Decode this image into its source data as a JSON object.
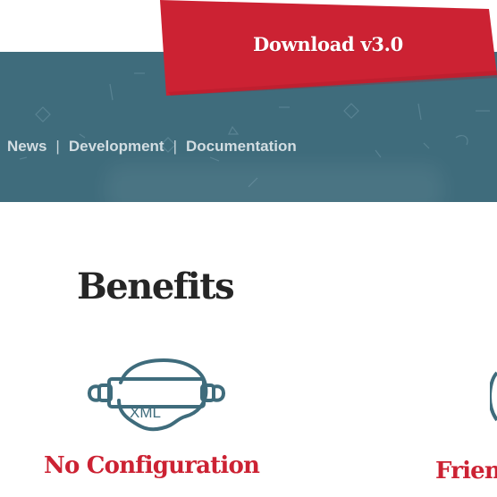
{
  "header": {
    "download_label": "Download v3.0"
  },
  "nav": {
    "items": [
      {
        "label": "News"
      },
      {
        "label": "Development"
      },
      {
        "label": "Documentation"
      }
    ],
    "separator": "|"
  },
  "benefits": {
    "heading": "Benefits",
    "items": [
      {
        "title": "No Configuration",
        "icon": "rolling-pin-xml-icon",
        "icon_text": "XML"
      },
      {
        "title": "Frien",
        "icon": "partial-circle-icon"
      }
    ]
  },
  "colors": {
    "hero_background": "#3f6c7c",
    "download_red": "#cc2233",
    "heading_text": "#262626",
    "icon_stroke": "#3f6c7c"
  }
}
